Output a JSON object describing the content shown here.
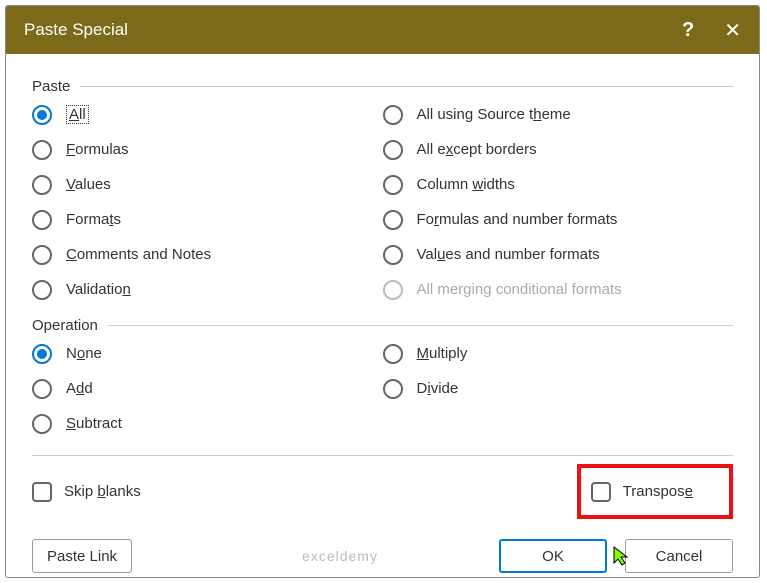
{
  "titlebar": {
    "title": "Paste Special",
    "help": "?",
    "close": "✕"
  },
  "labels": {
    "paste": "Paste",
    "operation": "Operation"
  },
  "paste_left": [
    {
      "pre": "",
      "ul": "A",
      "post": "ll",
      "selected": true,
      "dotted": true
    },
    {
      "pre": "",
      "ul": "F",
      "post": "ormulas",
      "selected": false
    },
    {
      "pre": "",
      "ul": "V",
      "post": "alues",
      "selected": false
    },
    {
      "pre": "Forma",
      "ul": "t",
      "post": "s",
      "selected": false
    },
    {
      "pre": "",
      "ul": "C",
      "post": "omments and Notes",
      "selected": false
    },
    {
      "pre": "Validatio",
      "ul": "n",
      "post": "",
      "selected": false
    }
  ],
  "paste_right": [
    {
      "pre": "All using Source t",
      "ul": "h",
      "post": "eme",
      "selected": false,
      "disabled": false
    },
    {
      "pre": "All e",
      "ul": "x",
      "post": "cept borders",
      "selected": false,
      "disabled": false
    },
    {
      "pre": "Column ",
      "ul": "w",
      "post": "idths",
      "selected": false,
      "disabled": false
    },
    {
      "pre": "Fo",
      "ul": "r",
      "post": "mulas and number formats",
      "selected": false,
      "disabled": false
    },
    {
      "pre": "Val",
      "ul": "u",
      "post": "es and number formats",
      "selected": false,
      "disabled": false
    },
    {
      "pre": "All mer",
      "ul": "g",
      "post": "ing conditional formats",
      "selected": false,
      "disabled": true
    }
  ],
  "op_left": [
    {
      "pre": "N",
      "ul": "o",
      "post": "ne",
      "selected": true
    },
    {
      "pre": "A",
      "ul": "d",
      "post": "d",
      "selected": false
    },
    {
      "pre": "",
      "ul": "S",
      "post": "ubtract",
      "selected": false
    }
  ],
  "op_right": [
    {
      "pre": "",
      "ul": "M",
      "post": "ultiply",
      "selected": false
    },
    {
      "pre": "D",
      "ul": "i",
      "post": "vide",
      "selected": false
    }
  ],
  "skip": {
    "pre": "Skip ",
    "ul": "b",
    "post": "lanks"
  },
  "transpose": {
    "pre": "Transpos",
    "ul": "e",
    "post": ""
  },
  "buttons": {
    "paste_link": "Paste Link",
    "ok": "OK",
    "cancel": "Cancel"
  },
  "watermark": "exceldemy"
}
